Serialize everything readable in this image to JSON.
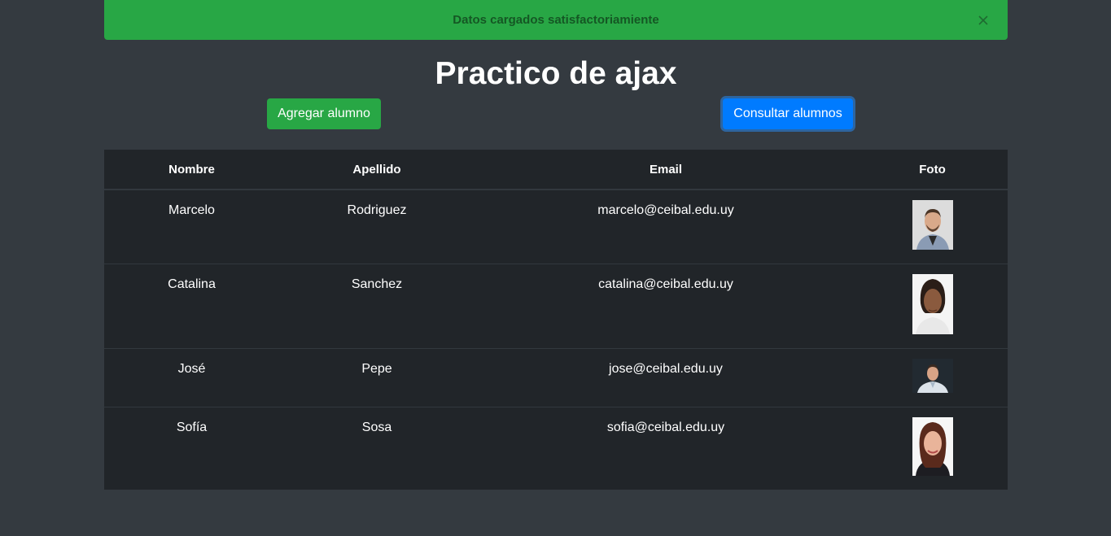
{
  "alert": {
    "message": "Datos cargados satisfactoriamiente",
    "close_symbol": "×"
  },
  "page": {
    "title": "Practico de ajax"
  },
  "buttons": {
    "add_label": "Agregar alumno",
    "query_label": "Consultar alumnos"
  },
  "table": {
    "headers": [
      "Nombre",
      "Apellido",
      "Email",
      "Foto"
    ],
    "rows": [
      {
        "nombre": "Marcelo",
        "apellido": "Rodriguez",
        "email": "marcelo@ceibal.edu.uy",
        "foto": "photo-marcelo"
      },
      {
        "nombre": "Catalina",
        "apellido": "Sanchez",
        "email": "catalina@ceibal.edu.uy",
        "foto": "photo-catalina"
      },
      {
        "nombre": "José",
        "apellido": "Pepe",
        "email": "jose@ceibal.edu.uy",
        "foto": "photo-jose"
      },
      {
        "nombre": "Sofía",
        "apellido": "Sosa",
        "email": "sofia@ceibal.edu.uy",
        "foto": "photo-sofia"
      }
    ]
  },
  "colors": {
    "background": "#343a40",
    "table_bg": "#212529",
    "success": "#28a745",
    "primary": "#007bff",
    "alert_text": "#155724"
  }
}
